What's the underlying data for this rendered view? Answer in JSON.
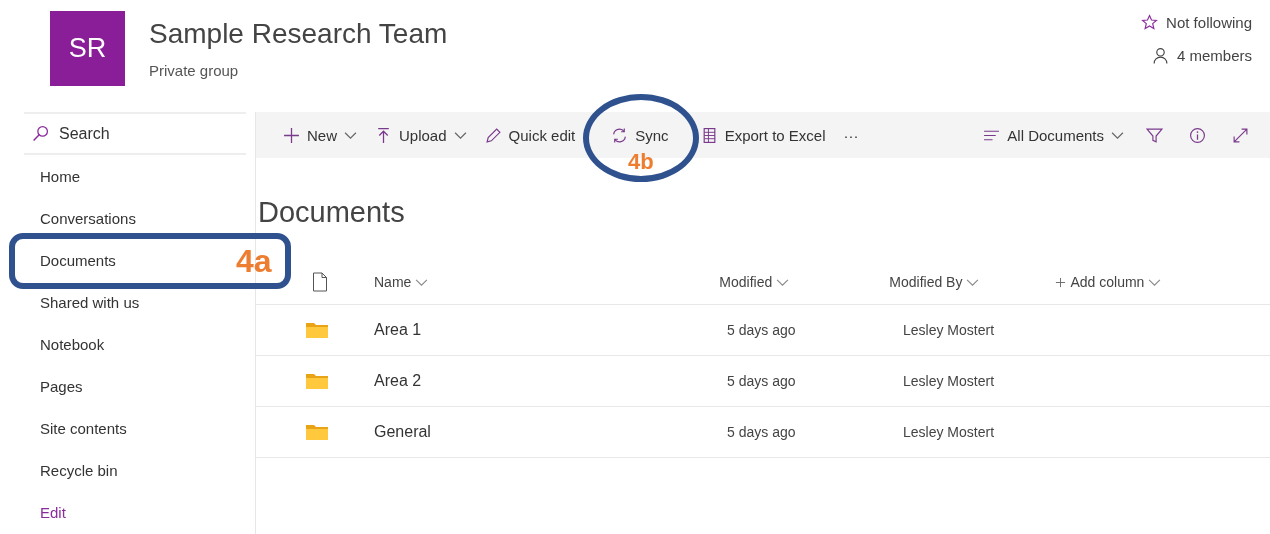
{
  "site": {
    "initials": "SR",
    "title": "Sample Research Team",
    "subtitle": "Private group",
    "follow": "Not following",
    "members": "4 members"
  },
  "search": {
    "placeholder": "Search"
  },
  "nav": [
    {
      "label": "Home",
      "kind": "link",
      "selected": false
    },
    {
      "label": "Conversations",
      "kind": "link",
      "selected": false
    },
    {
      "label": "Documents",
      "kind": "link",
      "selected": false
    },
    {
      "label": "Shared with us",
      "kind": "link",
      "selected": false
    },
    {
      "label": "Notebook",
      "kind": "link",
      "selected": false
    },
    {
      "label": "Pages",
      "kind": "link",
      "selected": false
    },
    {
      "label": "Site contents",
      "kind": "link",
      "selected": false
    },
    {
      "label": "Recycle bin",
      "kind": "link",
      "selected": false
    },
    {
      "label": "Edit",
      "kind": "edit",
      "selected": false
    }
  ],
  "toolbar": [
    {
      "label": "New",
      "kind": "plus",
      "caret": true
    },
    {
      "label": "Upload",
      "kind": "upload",
      "caret": true
    },
    {
      "label": "Quick edit",
      "kind": "pencil",
      "caret": false
    },
    {
      "label": "Sync",
      "kind": "sync",
      "caret": false
    },
    {
      "label": "Export to Excel",
      "kind": "sheet",
      "caret": false
    },
    {
      "label": "···",
      "kind": "more",
      "caret": false
    }
  ],
  "view": {
    "label": "All Documents"
  },
  "library": {
    "title": "Documents",
    "columns": [
      {
        "label": "Name"
      },
      {
        "label": "Modified"
      },
      {
        "label": "Modified By"
      },
      {
        "label": "Add column",
        "kind": "add"
      }
    ],
    "rows": [
      {
        "name": "Area 1",
        "modified": "5 days ago",
        "modified_by": "Lesley Mostert"
      },
      {
        "name": "Area 2",
        "modified": "5 days ago",
        "modified_by": "Lesley Mostert"
      },
      {
        "name": "General",
        "modified": "5 days ago",
        "modified_by": "Lesley Mostert"
      }
    ]
  },
  "annotations": [
    {
      "label": "4a"
    },
    {
      "label": "4b"
    }
  ]
}
